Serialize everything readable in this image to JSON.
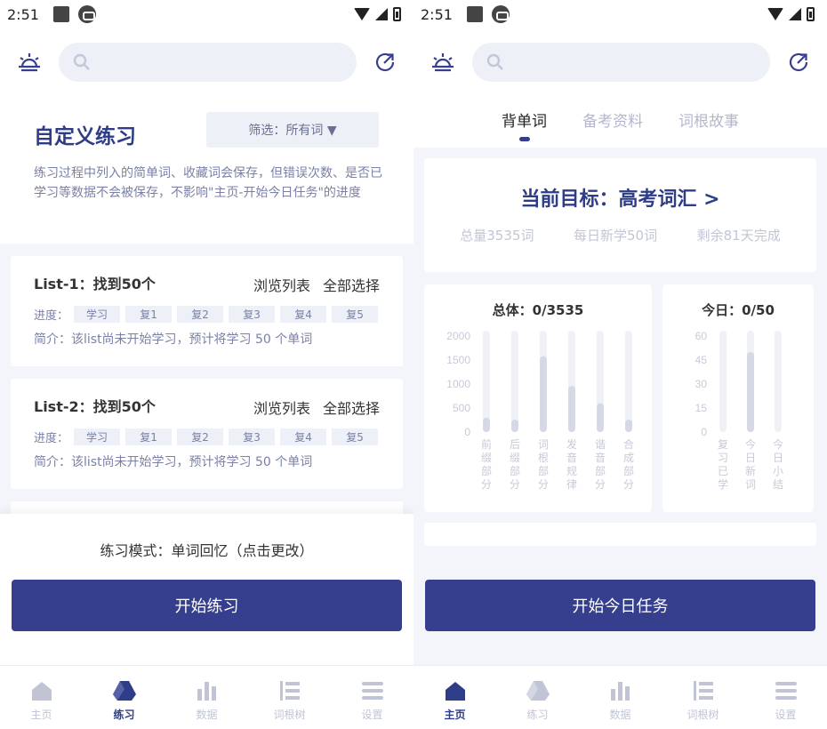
{
  "status": {
    "time": "2:51"
  },
  "left": {
    "title": "自定义练习",
    "filter_label": "筛选：所有词 ▼",
    "description": "练习过程中列入的简单词、收藏词会保存，但错误次数、是否已学习等数据不会被保存，不影响\"主页-开始今日任务\"的进度",
    "lists": [
      {
        "title": "List-1：找到50个",
        "browse": "浏览列表",
        "select_all": "全部选择",
        "progress_label": "进度：",
        "chips": [
          "学习",
          "复1",
          "复2",
          "复3",
          "复4",
          "复5"
        ],
        "intro": "简介：该list尚未开始学习，预计将学习 50 个单词"
      },
      {
        "title": "List-2：找到50个",
        "browse": "浏览列表",
        "select_all": "全部选择",
        "progress_label": "进度：",
        "chips": [
          "学习",
          "复1",
          "复2",
          "复3",
          "复4",
          "复5"
        ],
        "intro": "简介：该list尚未开始学习，预计将学习 50 个单词"
      }
    ],
    "mode_text": "练习模式：单词回忆（点击更改）",
    "start_button": "开始练习"
  },
  "right": {
    "tabs": [
      "背单词",
      "备考资料",
      "词根故事"
    ],
    "goal_title": "当前目标：高考词汇 >",
    "stats": [
      "总量3535词",
      "每日新学50词",
      "剩余81天完成"
    ],
    "total_title": "总体：0/3535",
    "today_title": "今日：0/50",
    "start_button": "开始今日任务"
  },
  "chart_data": [
    {
      "type": "bar",
      "title": "总体：0/3535",
      "categories": [
        "前缀部分",
        "后缀部分",
        "词根部分",
        "发音规律",
        "谐音部分",
        "合成部分"
      ],
      "values": [
        300,
        260,
        1580,
        960,
        600,
        260
      ],
      "ylim": [
        0,
        2000
      ],
      "yticks": [
        0,
        500,
        1000,
        1500,
        2000
      ]
    },
    {
      "type": "bar",
      "title": "今日：0/50",
      "categories": [
        "复习已学",
        "今日新词",
        "今日小结"
      ],
      "values": [
        0,
        50,
        0
      ],
      "ylim": [
        0,
        60
      ],
      "yticks": [
        0,
        15,
        30,
        45,
        60
      ]
    }
  ],
  "nav": {
    "left": [
      {
        "label": "主页",
        "icon": "home-icon"
      },
      {
        "label": "练习",
        "icon": "practice-icon"
      },
      {
        "label": "数据",
        "icon": "data-icon"
      },
      {
        "label": "词根树",
        "icon": "tree-icon"
      },
      {
        "label": "设置",
        "icon": "settings-icon"
      }
    ],
    "right": [
      {
        "label": "主页",
        "icon": "home-icon"
      },
      {
        "label": "练习",
        "icon": "practice-icon"
      },
      {
        "label": "数据",
        "icon": "data-icon"
      },
      {
        "label": "词根树",
        "icon": "tree-icon"
      },
      {
        "label": "设置",
        "icon": "settings-icon"
      }
    ]
  },
  "colors": {
    "accent": "#353f8e",
    "title": "#2f3c87",
    "muted": "#7a80a8",
    "bg": "#f4f5fa"
  }
}
